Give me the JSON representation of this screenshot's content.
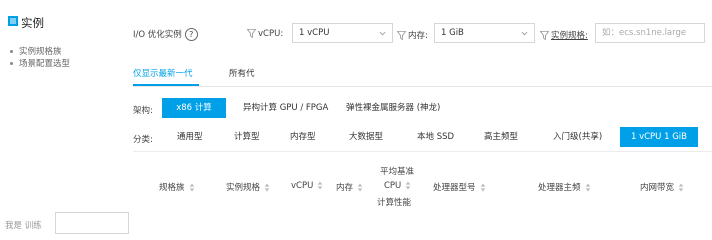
{
  "sidebar": {
    "title": "实例",
    "items": [
      {
        "label": "实例规格族"
      },
      {
        "label": "场景配置选型"
      }
    ]
  },
  "filters": {
    "io_optimized_label": "I/O 优化实例",
    "help_icon": "?",
    "vcpu_label": "vCPU:",
    "vcpu_value": "1 vCPU",
    "memory_label": "内存:",
    "memory_value": "1 GiB",
    "spec_label": "实例规格:",
    "spec_placeholder": "如：ecs.sn1ne.large"
  },
  "tabs": [
    {
      "label": "仅显示最新一代",
      "active": true
    },
    {
      "label": "所有代",
      "active": false
    }
  ],
  "architecture": {
    "label": "架构:",
    "options": [
      {
        "label": "x86 计算",
        "active": true
      },
      {
        "label": "异构计算 GPU / FPGA",
        "active": false
      },
      {
        "label": "弹性裸金属服务器 (神龙)",
        "active": false
      }
    ]
  },
  "category": {
    "label": "分类:",
    "options": [
      {
        "label": "通用型",
        "active": false
      },
      {
        "label": "计算型",
        "active": false
      },
      {
        "label": "内存型",
        "active": false
      },
      {
        "label": "大数据型",
        "active": false
      },
      {
        "label": "本地 SSD",
        "active": false
      },
      {
        "label": "高主频型",
        "active": false
      },
      {
        "label": "入门级(共享)",
        "active": false
      },
      {
        "label": "1 vCPU 1 GiB",
        "active": true
      }
    ]
  },
  "table": {
    "columns": [
      "规格族",
      "实例规格",
      "vCPU",
      "内存",
      "平均基准",
      "CPU",
      "计算性能",
      "处理器型号",
      "处理器主频",
      "内网带宽"
    ]
  },
  "footer": {
    "partial_text": "我是 训练"
  },
  "colors": {
    "accent": "#00a0e9"
  }
}
